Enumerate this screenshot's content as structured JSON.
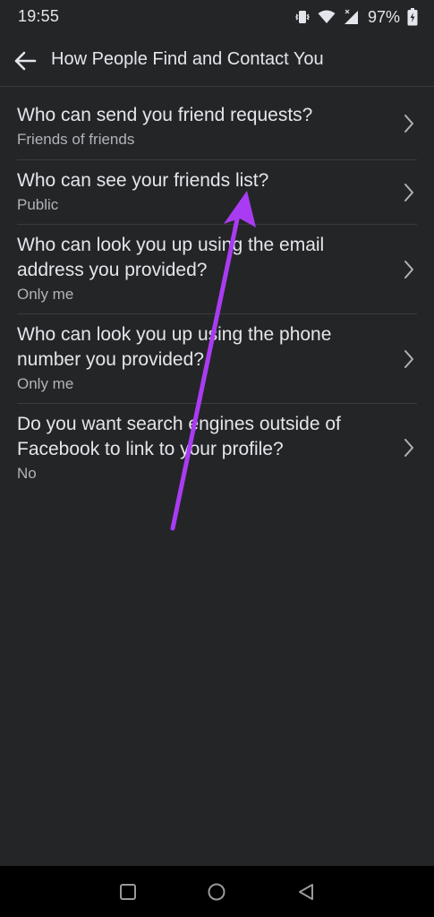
{
  "status_bar": {
    "time": "19:55",
    "battery_percent": "97%",
    "icons": [
      "vibrate-icon",
      "wifi-icon",
      "cell-signal-icon",
      "battery-icon"
    ]
  },
  "app_bar": {
    "title": "How People Find and Contact You",
    "back_icon": "arrow-left-icon"
  },
  "settings": {
    "items": [
      {
        "title": "Who can send you friend requests?",
        "value": "Friends of friends"
      },
      {
        "title": "Who can see your friends list?",
        "value": "Public"
      },
      {
        "title": "Who can look you up using the email address you provided?",
        "value": "Only me"
      },
      {
        "title": "Who can look you up using the phone number you provided?",
        "value": "Only me"
      },
      {
        "title": "Do you want search engines outside of Facebook to link to your profile?",
        "value": "No"
      }
    ]
  },
  "annotation": {
    "color": "#a93cf2"
  },
  "nav_bar": {
    "buttons": [
      "recents-square-icon",
      "home-circle-icon",
      "back-triangle-icon"
    ]
  },
  "colors": {
    "background": "#242527",
    "text_primary": "#e4e6eb",
    "text_secondary": "#b0b3b8",
    "divider": "#3a3b3d"
  }
}
